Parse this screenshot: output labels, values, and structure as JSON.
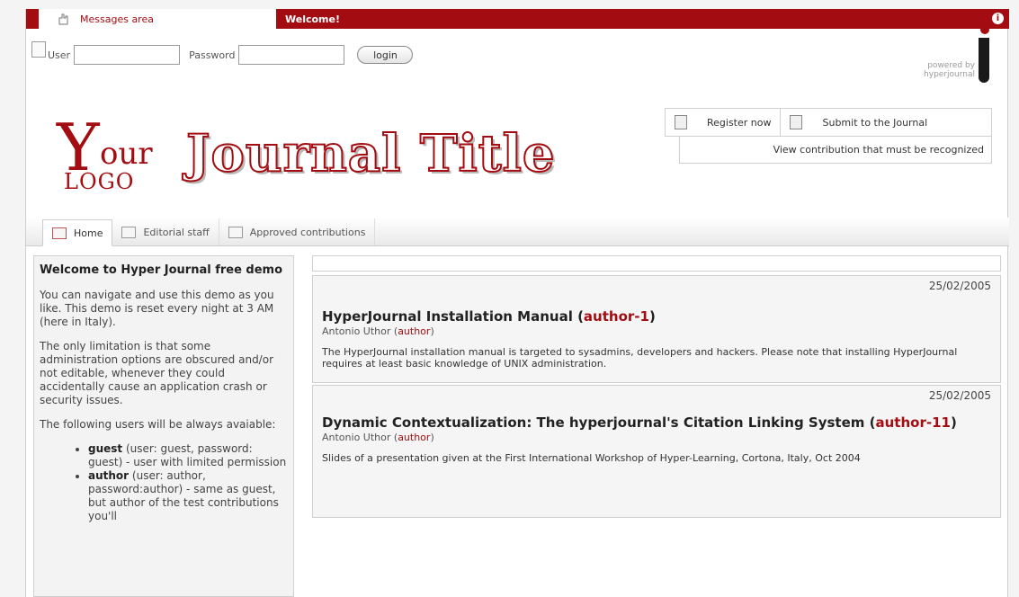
{
  "topbar": {
    "messages_label": "Messages area",
    "welcome_label": "Welcome!",
    "info_icon": "i"
  },
  "login": {
    "user_label": "User",
    "user_value": "",
    "password_label": "Password",
    "password_value": "",
    "login_button": "login"
  },
  "powered": {
    "text": "powered by hyperjournal"
  },
  "logo": {
    "y": "Y",
    "our": "our",
    "logo_word": "LOGO"
  },
  "journal": {
    "title": "Journal Title"
  },
  "actions": {
    "register": "Register now",
    "submit": "Submit to the Journal",
    "view": "View contribution that must be recognized"
  },
  "tabs": [
    {
      "label": "Home",
      "icon": "home-icon"
    },
    {
      "label": "Editorial staff",
      "icon": "envelope-icon"
    },
    {
      "label": "Approved contributions",
      "icon": "envelope-icon"
    }
  ],
  "sidebar": {
    "heading": "Welcome to Hyper Journal free demo",
    "p1": "You can navigate and use this demo as you like. This demo is reset every night at 3 AM (here in Italy).",
    "p2": "The only limitation is that some administration options are obscured and/or not editable, whenever they could accidentally cause an application crash or security issues.",
    "p3": "The following users will be always avaiable:",
    "users": [
      {
        "name": "guest",
        "desc": " (user: guest, password: guest) - user with limited permission"
      },
      {
        "name": "author",
        "desc": " (user: author, password:author) - same as guest, but author of the test contributions you'll"
      }
    ]
  },
  "articles": [
    {
      "date": "25/02/2005",
      "title": "HyperJournal Installation Manual",
      "author_tag": "author-1",
      "byline_name": "Antonio Uthor",
      "byline_role": "author",
      "abstract": "The HyperJournal installation manual is targeted to sysadmins, developers and hackers. Please note that installing HyperJournal requires at least basic knowledge of UNIX administration."
    },
    {
      "date": "25/02/2005",
      "title": "Dynamic Contextualization: The hyperjournal's Citation Linking System",
      "author_tag": "author-11",
      "byline_name": "Antonio Uthor",
      "byline_role": "author",
      "abstract": "Slides of a presentation given at the First International Workshop of Hyper-Learning, Cortona, Italy, Oct 2004"
    }
  ],
  "colors": {
    "accent": "#a30d12"
  }
}
